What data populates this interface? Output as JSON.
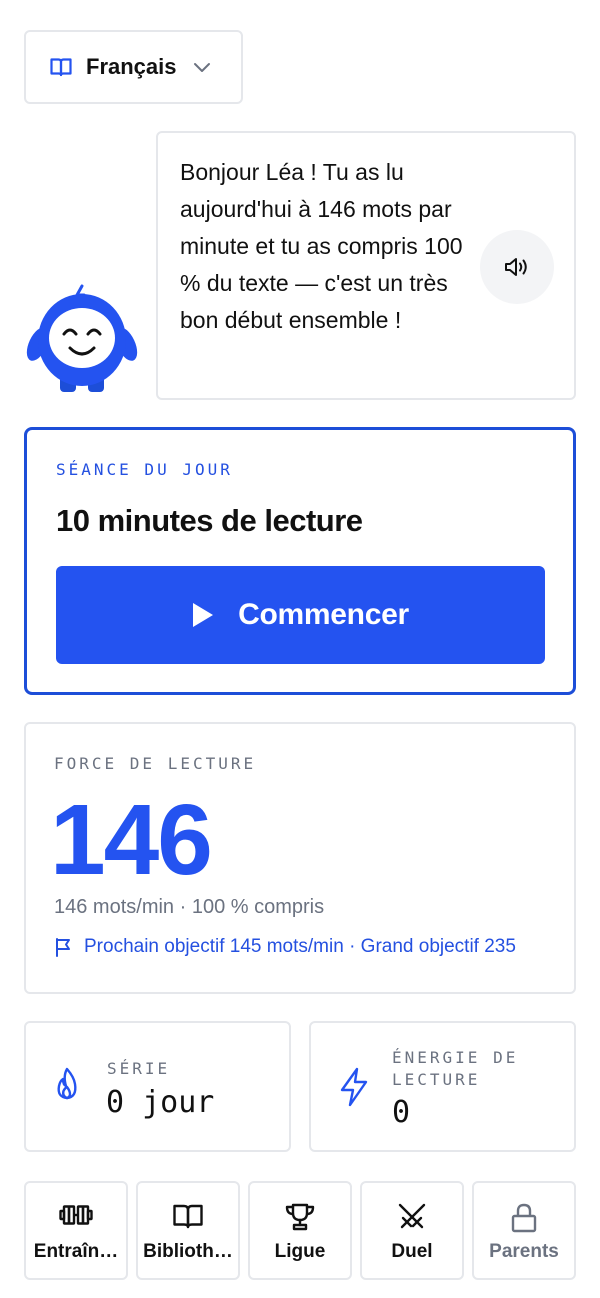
{
  "language_selector": {
    "label": "Français",
    "icon": "book-icon"
  },
  "mascot": {
    "icon": "robot-mascot",
    "color": "#2453f0"
  },
  "bubble": {
    "message": "Bonjour Léa ! Tu as lu aujourd'hui à 146 mots par minute et tu as compris 100 % du texte — c'est un très bon début ensemble !",
    "speaker_icon": "speaker-icon"
  },
  "session": {
    "tag": "SÉANCE DU JOUR",
    "title": "10 minutes de lecture",
    "button_label": "Commencer"
  },
  "force": {
    "tag": "FORCE DE LECTURE",
    "value": "146",
    "subtitle": "146 mots/min · 100 % compris",
    "goal": "Prochain objectif 145 mots/min · Grand objectif 235"
  },
  "streak": {
    "tag": "SÉRIE",
    "value": "0 jour",
    "icon": "flame-icon"
  },
  "energy": {
    "tag": "ÉNERGIE DE LECTURE",
    "value": "0",
    "icon": "lightning-icon"
  },
  "nav": [
    {
      "label": "Entraîn…",
      "icon": "dumbbell-icon"
    },
    {
      "label": "Biblioth…",
      "icon": "book-icon"
    },
    {
      "label": "Ligue",
      "icon": "trophy-icon"
    },
    {
      "label": "Duel",
      "icon": "crossed-swords-icon"
    },
    {
      "label": "Parents",
      "icon": "lock-icon"
    }
  ],
  "colors": {
    "accent": "#2453f0",
    "accent_text": "#2450e0",
    "muted": "#6b7280",
    "border": "#e5e7eb"
  }
}
